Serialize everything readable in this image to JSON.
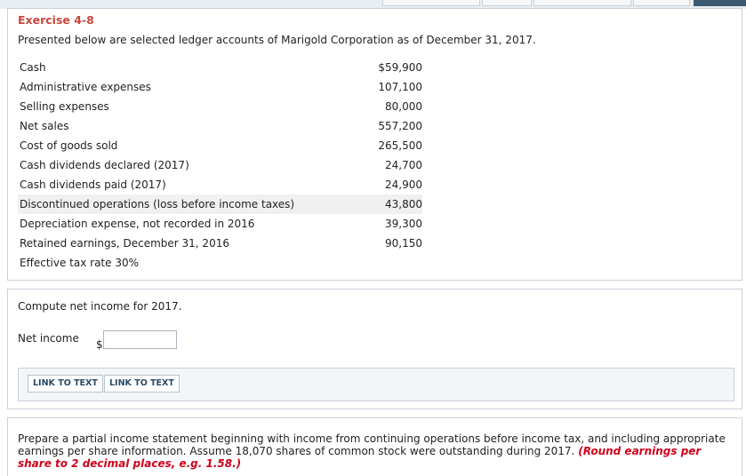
{
  "exercise": {
    "title": "Exercise 4-8",
    "intro": "Presented below are selected ledger accounts of Marigold Corporation as of December 31, 2017."
  },
  "ledger": [
    {
      "label": "Cash",
      "amount": "$59,900"
    },
    {
      "label": "Administrative expenses",
      "amount": "107,100"
    },
    {
      "label": "Selling expenses",
      "amount": "80,000"
    },
    {
      "label": "Net sales",
      "amount": "557,200"
    },
    {
      "label": "Cost of goods sold",
      "amount": "265,500"
    },
    {
      "label": "Cash dividends declared (2017)",
      "amount": "24,700"
    },
    {
      "label": "Cash dividends paid (2017)",
      "amount": "24,900"
    },
    {
      "label": "Discontinued operations (loss before income taxes)",
      "amount": "43,800"
    },
    {
      "label": "Depreciation expense, not recorded in 2016",
      "amount": "39,300"
    },
    {
      "label": "Retained earnings, December 31, 2016",
      "amount": "90,150"
    },
    {
      "label": "Effective tax rate 30%",
      "amount": ""
    }
  ],
  "question1": {
    "prompt": "Compute net income for 2017.",
    "net_income_label": "Net income",
    "currency": "$",
    "net_income_value": ""
  },
  "links": {
    "link1": "LINK TO TEXT",
    "link2": "LINK TO TEXT"
  },
  "question2": {
    "prompt": "Prepare a partial income statement beginning with income from continuing operations before income tax, and including appropriate earnings per share information. Assume 18,070 shares of common stock were outstanding during 2017.",
    "instruction": "(Round earnings per share to 2 decimal places, e.g. 1.58.)"
  }
}
